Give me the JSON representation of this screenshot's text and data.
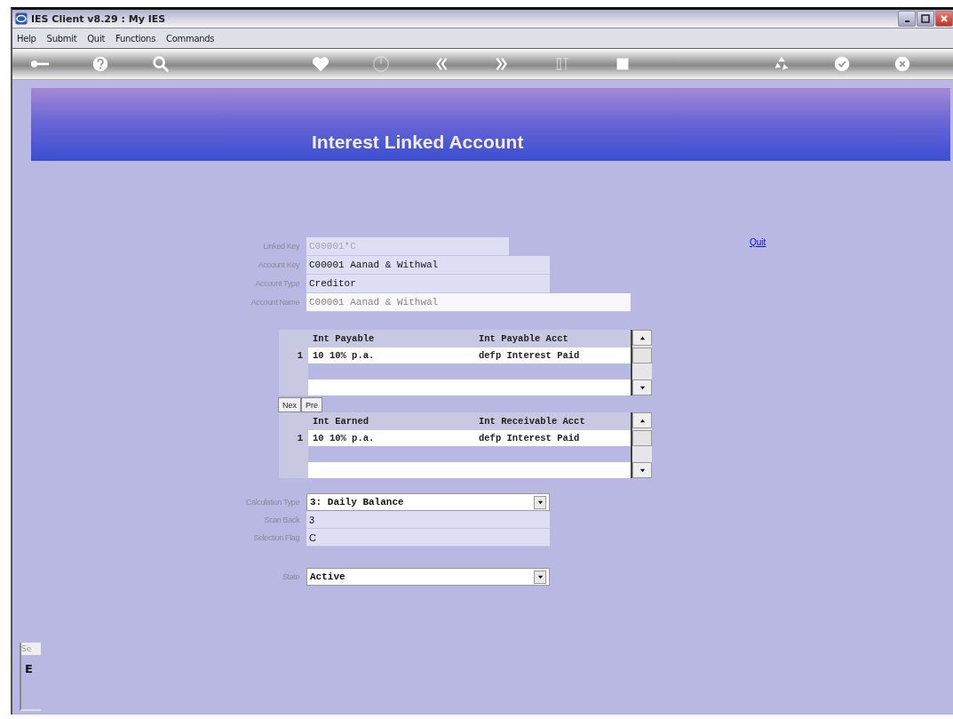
{
  "window": {
    "title": "IES Client v8.29 : My IES"
  },
  "menu": [
    "Help",
    "Submit",
    "Quit",
    "Functions",
    "Commands"
  ],
  "toolbar": [
    {
      "kind": "key",
      "disabled": false
    },
    {
      "kind": "help",
      "disabled": false
    },
    {
      "kind": "search",
      "disabled": false
    },
    {
      "kind": "spacer"
    },
    {
      "kind": "heart",
      "disabled": false
    },
    {
      "kind": "clock",
      "disabled": true
    },
    {
      "kind": "rewind",
      "disabled": false
    },
    {
      "kind": "forward",
      "disabled": false
    },
    {
      "kind": "cursor",
      "disabled": true
    },
    {
      "kind": "square",
      "disabled": false
    },
    {
      "kind": "spacer"
    },
    {
      "kind": "recycle",
      "disabled": false
    },
    {
      "kind": "check",
      "disabled": false
    },
    {
      "kind": "close",
      "disabled": false
    }
  ],
  "banner": {
    "title": "Interest Linked Account"
  },
  "quit_link": "Quit",
  "fields": [
    {
      "label": "Linked Key",
      "value": "C00001*C",
      "kind": "readonly"
    },
    {
      "label": "Account Key",
      "value": "C00001 Aanad & Withwal",
      "kind": "text"
    },
    {
      "label": "Account Type",
      "value": "Creditor",
      "kind": "text"
    },
    {
      "label": "Account Name",
      "value": "C00001 Aanad & Withwal",
      "kind": "display"
    }
  ],
  "grids": [
    {
      "columns": [
        "Int Payable",
        "Int Payable Acct"
      ],
      "rows": [
        {
          "number": "1",
          "cells": [
            "10 10% p.a.",
            "defp Interest Paid"
          ]
        }
      ]
    },
    {
      "columns": [
        "Int Earned",
        "Int Receivable Acct"
      ],
      "rows": [
        {
          "number": "1",
          "cells": [
            "10 10% p.a.",
            "defp Interest Paid"
          ]
        }
      ]
    }
  ],
  "nav_buttons": [
    "Nex",
    "Pre"
  ],
  "settings": [
    {
      "label": "Calculation Type",
      "value": "3: Daily Balance",
      "kind": "select"
    },
    {
      "label": "Scan Back",
      "value": "3",
      "kind": "text"
    },
    {
      "label": "Selection Flag",
      "value": "C",
      "kind": "text"
    },
    {
      "label": "State",
      "value": "Active",
      "kind": "select"
    }
  ],
  "side_panel": {
    "tab": "Se",
    "glyph": "E"
  }
}
